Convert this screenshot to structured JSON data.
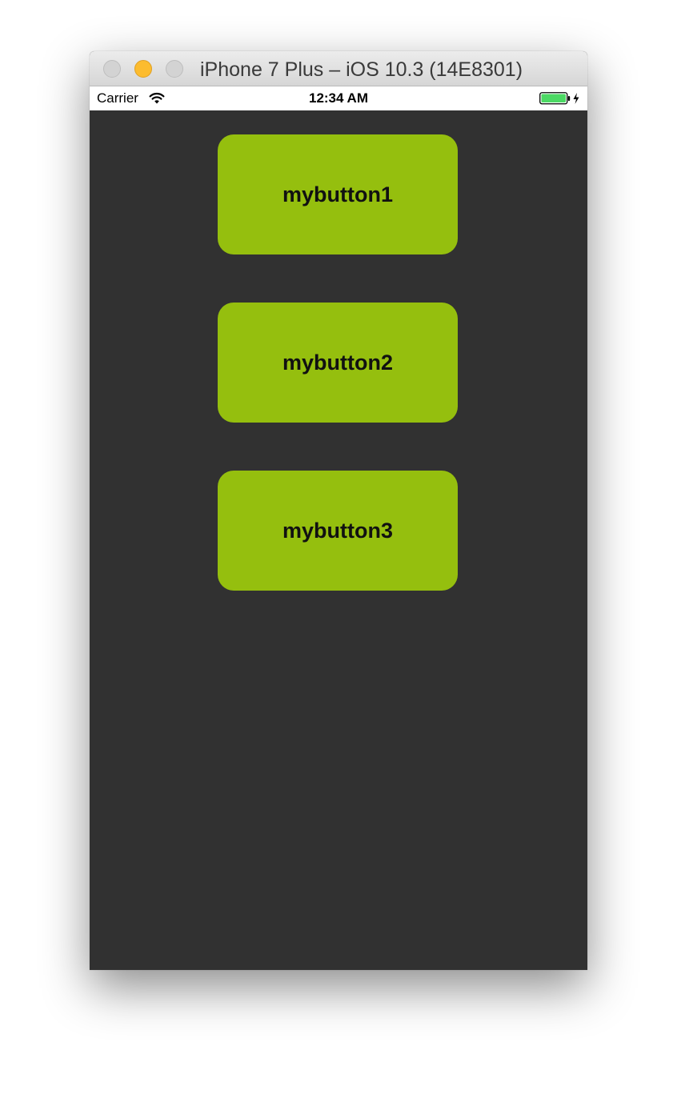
{
  "window": {
    "title": "iPhone 7 Plus – iOS 10.3 (14E8301)"
  },
  "status_bar": {
    "carrier": "Carrier",
    "time": "12:34 AM",
    "battery_color": "#4cd964",
    "icons": [
      "wifi-icon",
      "battery-icon",
      "charging-bolt-icon"
    ]
  },
  "app": {
    "background_color": "#313131",
    "button_color": "#95bf0e",
    "buttons": [
      {
        "label": "mybutton1"
      },
      {
        "label": "mybutton2"
      },
      {
        "label": "mybutton3"
      }
    ]
  }
}
